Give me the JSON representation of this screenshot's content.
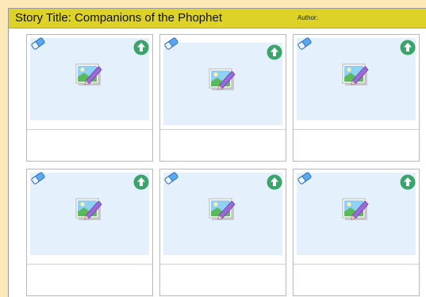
{
  "header": {
    "story_title": "Story Title: Companions of the Phophet",
    "author_label": "Author:"
  },
  "cells": [
    {
      "eraser_icon": "eraser-icon",
      "upload_icon": "upload-icon",
      "image_icon": "image-placeholder-icon",
      "caption": ""
    },
    {
      "eraser_icon": "eraser-icon",
      "upload_icon": "upload-icon",
      "image_icon": "image-placeholder-icon",
      "caption": ""
    },
    {
      "eraser_icon": "eraser-icon",
      "upload_icon": "upload-icon",
      "image_icon": "image-placeholder-icon",
      "caption": ""
    },
    {
      "eraser_icon": "eraser-icon",
      "upload_icon": "upload-icon",
      "image_icon": "image-placeholder-icon",
      "caption": ""
    },
    {
      "eraser_icon": "eraser-icon",
      "upload_icon": "upload-icon",
      "image_icon": "image-placeholder-icon",
      "caption": ""
    },
    {
      "eraser_icon": "eraser-icon",
      "upload_icon": "upload-icon",
      "image_icon": "image-placeholder-icon",
      "caption": ""
    }
  ],
  "colors": {
    "page_background": "#fde9b8",
    "header_background": "#dcd228",
    "image_area": "#e4f1fd",
    "upload_green": "#3aa46a"
  }
}
